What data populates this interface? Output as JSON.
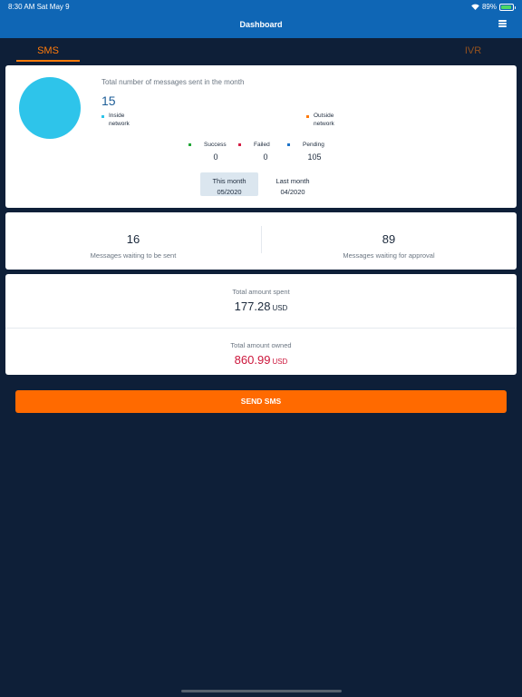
{
  "status_bar": {
    "time_date": "8:30 AM   Sat May 9",
    "battery": "89%",
    "battery_level": 0.89
  },
  "nav": {
    "title": "Dashboard"
  },
  "tabs": [
    {
      "label": "SMS",
      "active": true
    },
    {
      "label": "IVR",
      "active": false
    }
  ],
  "summary": {
    "title": "Total number of messages sent in the month",
    "total": "15",
    "legend": [
      {
        "label": "Inside\nnetwork",
        "color": "#2ec4ea"
      },
      {
        "label": "Outside\nnetwork",
        "color": "#ff7a0a"
      }
    ],
    "statuses": [
      {
        "label": "Success",
        "value": "0",
        "color": "#21a637"
      },
      {
        "label": "Failed",
        "value": "0",
        "color": "#d41e44"
      },
      {
        "label": "Pending",
        "value": "105",
        "color": "#1e73c8"
      }
    ],
    "pie_color": "#2ec4ea",
    "months": [
      {
        "label": "This month",
        "value": "05/2020",
        "active": true
      },
      {
        "label": "Last month",
        "value": "04/2020",
        "active": false
      }
    ]
  },
  "waiting": {
    "to_send": {
      "value": "16",
      "label": "Messages waiting to be sent"
    },
    "approval": {
      "value": "89",
      "label": "Messages waiting for approval"
    }
  },
  "amounts": {
    "spent": {
      "label": "Total amount spent",
      "value": "177.28",
      "currency": "USD"
    },
    "owned": {
      "label": "Total amount owned",
      "value": "860.99",
      "currency": "USD"
    }
  },
  "send_button": {
    "label": "SEND SMS"
  }
}
